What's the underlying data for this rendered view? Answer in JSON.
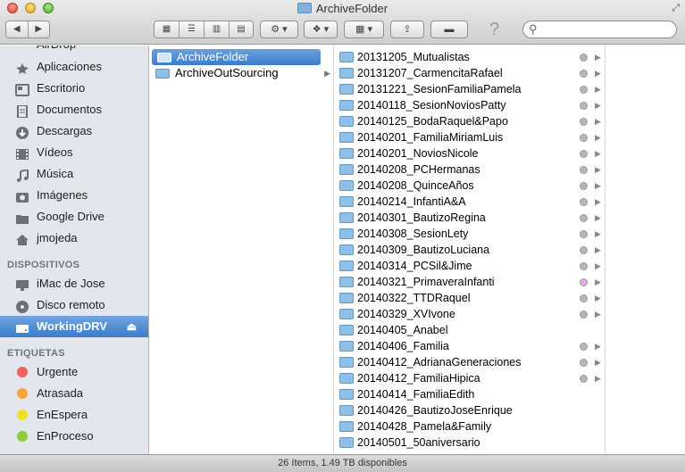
{
  "window": {
    "title": "ArchiveFolder"
  },
  "toolbar": {
    "back_icon": "chevron-left-icon",
    "forward_icon": "chevron-right-icon",
    "view_modes": [
      "icons",
      "list",
      "columns",
      "cover-flow"
    ],
    "active_view": "columns",
    "action_icon": "gear-icon",
    "dropbox_icon": "dropbox-icon",
    "arrange_icon": "grid-icon",
    "share_icon": "share-icon",
    "tags_icon": "toggle-icon",
    "help_label": "?",
    "search": {
      "value": "",
      "placeholder": ""
    }
  },
  "sidebar": {
    "partial_top": "AirDrop",
    "favorites": [
      {
        "label": "Aplicaciones",
        "icon": "applications-icon"
      },
      {
        "label": "Escritorio",
        "icon": "desktop-icon"
      },
      {
        "label": "Documentos",
        "icon": "documents-icon"
      },
      {
        "label": "Descargas",
        "icon": "downloads-icon"
      },
      {
        "label": "Vídeos",
        "icon": "movies-icon"
      },
      {
        "label": "Música",
        "icon": "music-icon"
      },
      {
        "label": "Imágenes",
        "icon": "pictures-icon"
      },
      {
        "label": "Google Drive",
        "icon": "folder-icon"
      },
      {
        "label": "jmojeda",
        "icon": "home-icon"
      }
    ],
    "devices_header": "DISPOSITIVOS",
    "devices": [
      {
        "label": "iMac de Jose",
        "icon": "imac-icon"
      },
      {
        "label": "Disco remoto",
        "icon": "disc-icon"
      },
      {
        "label": "WorkingDRV",
        "icon": "drive-icon",
        "selected": true
      }
    ],
    "tags_header": "ETIQUETAS",
    "tags": [
      {
        "label": "Urgente",
        "color": "#f0625b"
      },
      {
        "label": "Atrasada",
        "color": "#f6a63a"
      },
      {
        "label": "EnEspera",
        "color": "#f2df2c"
      },
      {
        "label": "EnProceso",
        "color": "#8fcc3c"
      }
    ]
  },
  "column1": [
    {
      "label": "ArchiveFolder",
      "selected": true
    },
    {
      "label": "ArchiveOutSourcing",
      "selected": false
    }
  ],
  "column2": [
    {
      "label": "20131205_Mutualistas",
      "tag": "#b7b7b7"
    },
    {
      "label": "20131207_CarmencitaRafael",
      "tag": "#b7b7b7"
    },
    {
      "label": "20131221_SesionFamiliaPamela",
      "tag": "#b7b7b7"
    },
    {
      "label": "20140118_SesionNoviosPatty",
      "tag": "#b7b7b7"
    },
    {
      "label": "20140125_BodaRaquel&Papo",
      "tag": "#b7b7b7"
    },
    {
      "label": "20140201_FamiliaMiriamLuis",
      "tag": "#b7b7b7"
    },
    {
      "label": "20140201_NoviosNicole",
      "tag": "#b7b7b7"
    },
    {
      "label": "20140208_PCHermanas",
      "tag": "#b7b7b7"
    },
    {
      "label": "20140208_QuinceAños",
      "tag": "#b7b7b7"
    },
    {
      "label": "20140214_InfantiA&A",
      "tag": "#b7b7b7"
    },
    {
      "label": "20140301_BautizoRegina",
      "tag": "#b7b7b7"
    },
    {
      "label": "20140308_SesionLety",
      "tag": "#b7b7b7"
    },
    {
      "label": "20140309_BautizoLuciana",
      "tag": "#b7b7b7"
    },
    {
      "label": "20140314_PCSil&Jime",
      "tag": "#b7b7b7"
    },
    {
      "label": "20140321_PrimaveraInfanti",
      "tag": "#e6a6ec"
    },
    {
      "label": "20140322_TTDRaquel",
      "tag": "#b7b7b7"
    },
    {
      "label": "20140329_XVIvone",
      "tag": "#b7b7b7"
    },
    {
      "label": "20140405_Anabel",
      "tag": ""
    },
    {
      "label": "20140406_Familia",
      "tag": "#b7b7b7"
    },
    {
      "label": "20140412_AdrianaGeneraciones",
      "tag": "#b7b7b7"
    },
    {
      "label": "20140412_FamiliaHipica",
      "tag": "#b7b7b7"
    },
    {
      "label": "20140414_FamiliaEdith",
      "tag": ""
    },
    {
      "label": "20140426_BautizoJoseEnrique",
      "tag": ""
    },
    {
      "label": "20140428_Pamela&Family",
      "tag": ""
    },
    {
      "label": "20140501_50aniversario",
      "tag": ""
    }
  ],
  "status": {
    "text": "26 ítems, 1.49 TB disponibles"
  }
}
